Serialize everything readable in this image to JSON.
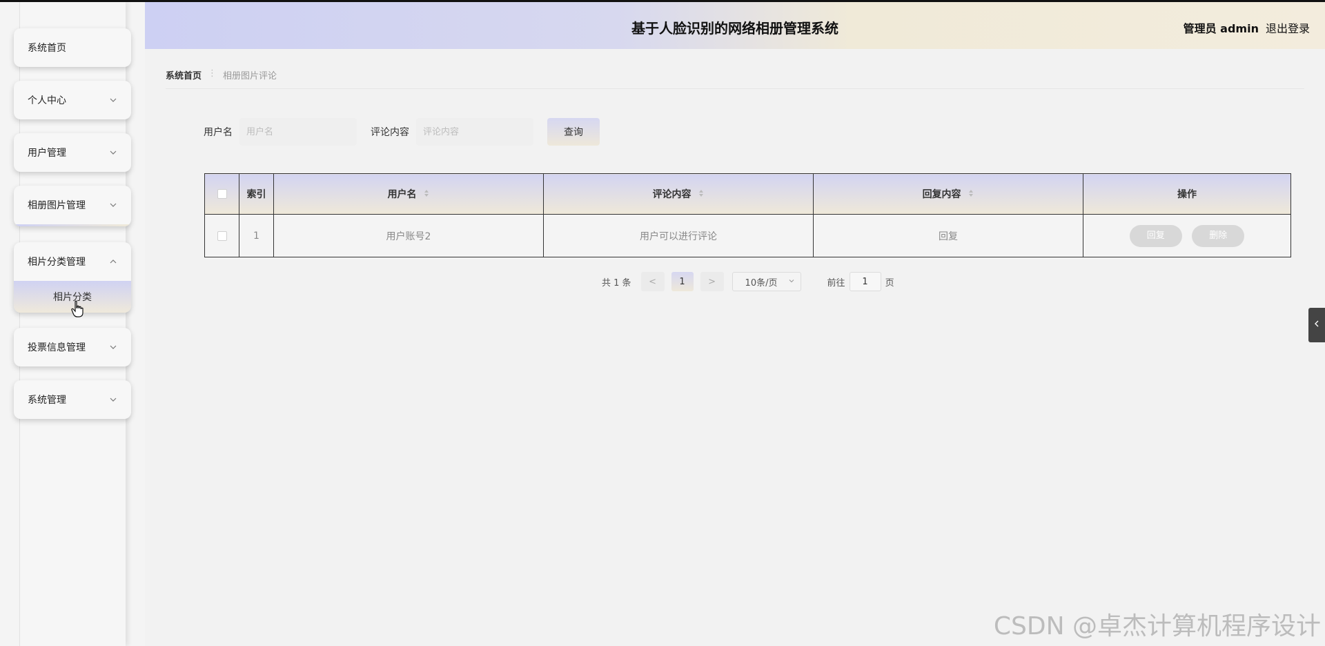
{
  "header": {
    "title": "基于人脸识别的网络相册管理系统",
    "user": "管理员 admin",
    "logout": "退出登录"
  },
  "sidebar": {
    "items": [
      {
        "label": "系统首页",
        "expandable": false
      },
      {
        "label": "个人中心",
        "expandable": true
      },
      {
        "label": "用户管理",
        "expandable": true
      },
      {
        "label": "相册图片管理",
        "expandable": true
      },
      {
        "label": "相片分类管理",
        "expandable": true,
        "expanded": true,
        "children": [
          "相片分类"
        ]
      },
      {
        "label": "投票信息管理",
        "expandable": true
      },
      {
        "label": "系统管理",
        "expandable": true
      }
    ]
  },
  "breadcrumb": {
    "home": "系统首页",
    "separator": "⋮",
    "current": "相册图片评论"
  },
  "search": {
    "username_label": "用户名",
    "username_placeholder": "用户名",
    "username_value": "",
    "comment_label": "评论内容",
    "comment_placeholder": "评论内容",
    "comment_value": "",
    "query_button": "查询"
  },
  "table": {
    "columns": [
      "",
      "索引",
      "用户名",
      "评论内容",
      "回复内容",
      "操作"
    ],
    "rows": [
      {
        "index": "1",
        "username": "用户账号2",
        "comment": "用户可以进行评论",
        "reply": "回复",
        "actions": [
          "回复",
          "删除"
        ]
      }
    ]
  },
  "pagination": {
    "total": "共 1 条",
    "prev": "<",
    "current_page": "1",
    "next": ">",
    "page_size": "10条/页",
    "goto_label": "前往",
    "goto_value": "1",
    "page_suffix": "页"
  },
  "watermark": "CSDN @卓杰计算机程序设计",
  "colors": {
    "accent_lavender": "#cdd0f3",
    "accent_cream": "#f0ead8",
    "background": "#f2f2f2"
  }
}
